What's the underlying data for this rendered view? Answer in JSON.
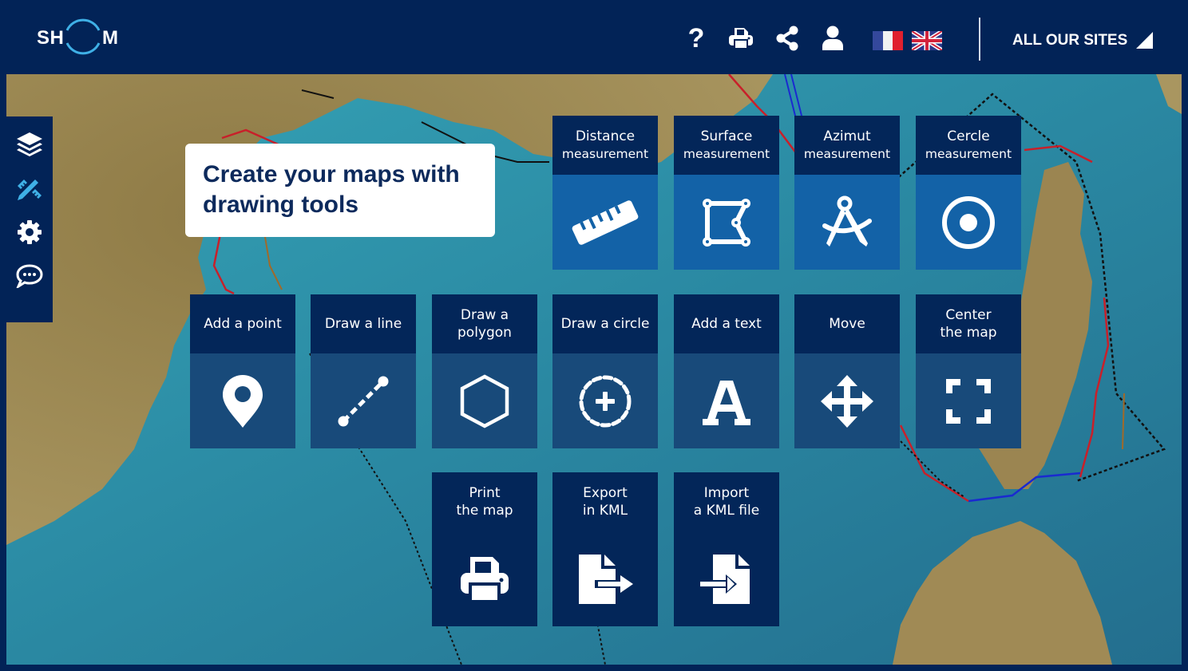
{
  "header": {
    "logo_left": "SH",
    "logo_right": "M",
    "icons": [
      {
        "name": "help-icon",
        "label": "?"
      },
      {
        "name": "print-icon"
      },
      {
        "name": "share-icon"
      },
      {
        "name": "user-icon"
      }
    ],
    "languages": [
      "fr",
      "en"
    ],
    "all_sites_label": "ALL OUR SITES"
  },
  "sidebar": {
    "items": [
      {
        "name": "layers-icon",
        "active": false
      },
      {
        "name": "drawing-tools-icon",
        "active": true
      },
      {
        "name": "settings-icon",
        "active": false
      },
      {
        "name": "chat-icon",
        "active": false
      }
    ]
  },
  "callout": {
    "line1": "Create your maps with",
    "line2": "drawing tools"
  },
  "tools": {
    "measurement": [
      {
        "line1": "Distance",
        "line2": "measurement",
        "icon": "ruler-icon"
      },
      {
        "line1": "Surface",
        "line2": "measurement",
        "icon": "surface-icon"
      },
      {
        "line1": "Azimut",
        "line2": "measurement",
        "icon": "compass-icon"
      },
      {
        "line1": "Cercle",
        "line2": "measurement",
        "icon": "circle-target-icon"
      }
    ],
    "drawing": [
      {
        "line1": "Add a point",
        "line2": "",
        "icon": "map-pin-icon"
      },
      {
        "line1": "Draw a line",
        "line2": "",
        "icon": "line-icon"
      },
      {
        "line1": "Draw a",
        "line2": "polygon",
        "icon": "hexagon-icon"
      },
      {
        "line1": "Draw a circle",
        "line2": "",
        "icon": "dashed-circle-plus-icon"
      },
      {
        "line1": "Add a text",
        "line2": "",
        "icon": "text-icon"
      },
      {
        "line1": "Move",
        "line2": "",
        "icon": "move-arrows-icon"
      },
      {
        "line1": "Center",
        "line2": "the map",
        "icon": "fullscreen-icon"
      }
    ],
    "file": [
      {
        "line1": "Print",
        "line2": "the map",
        "icon": "print-icon"
      },
      {
        "line1": "Export",
        "line2": "in KML",
        "icon": "file-export-icon"
      },
      {
        "line1": "Import",
        "line2": "a KML file",
        "icon": "file-import-icon"
      }
    ]
  },
  "colors": {
    "navy": "#022357",
    "accent": "#3fb0e6",
    "tile_measure": "#1362a7",
    "tile_draw": "#184a7a"
  }
}
